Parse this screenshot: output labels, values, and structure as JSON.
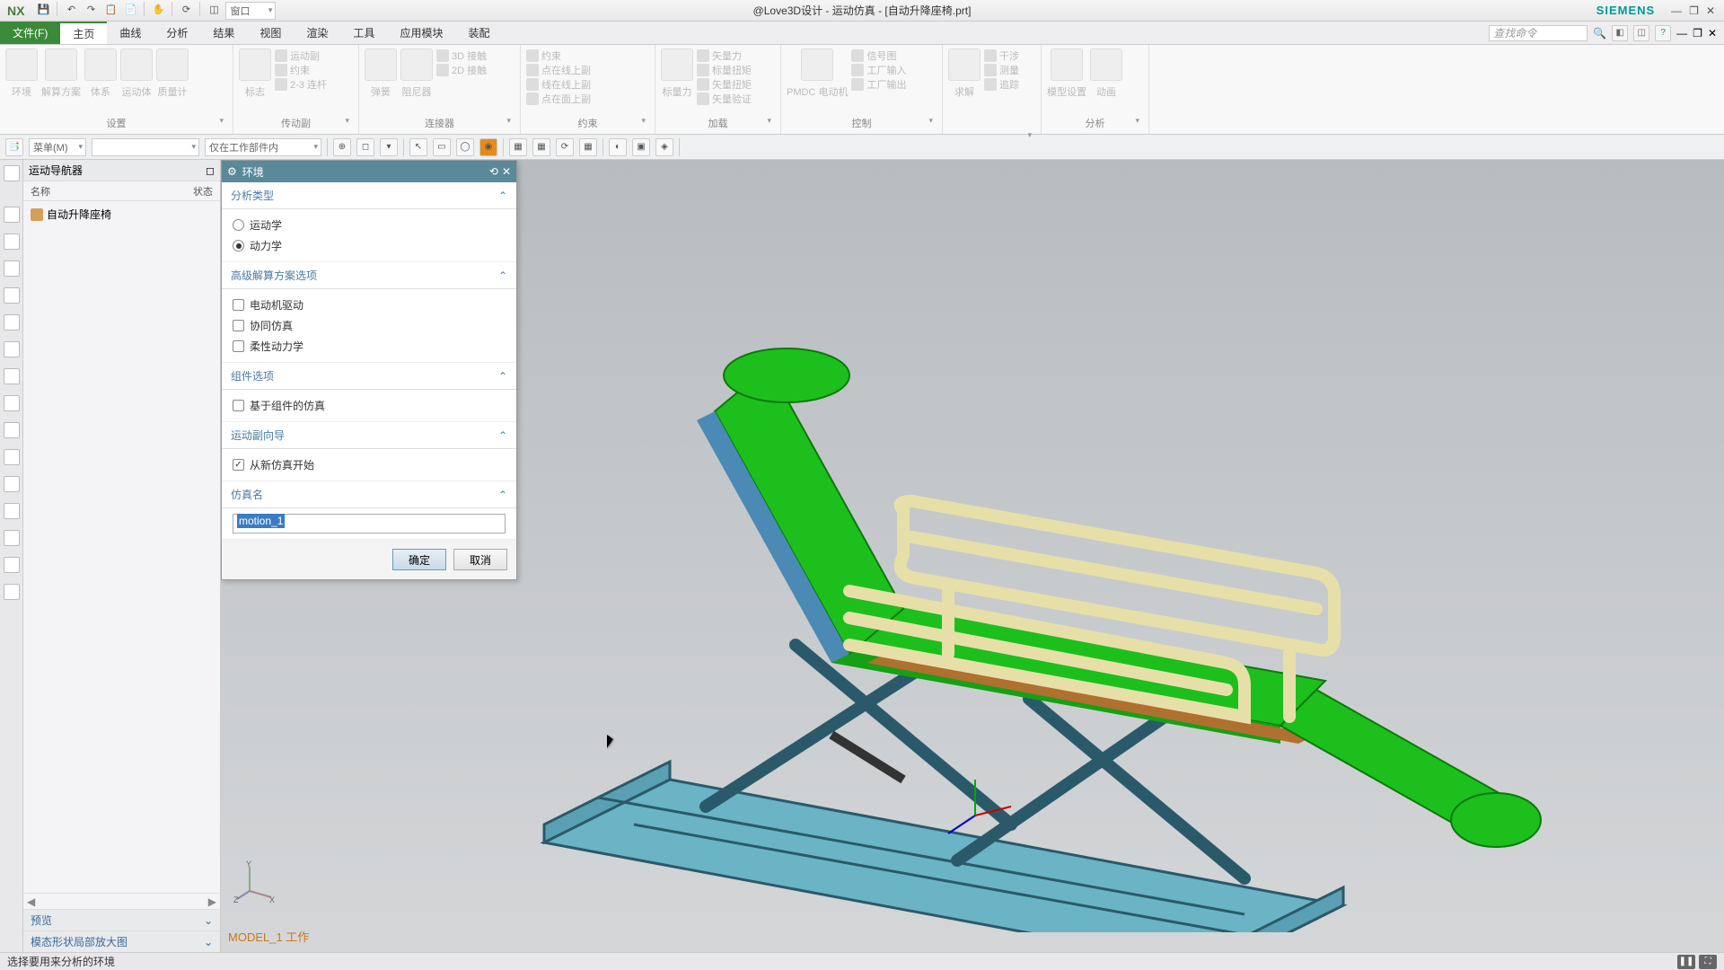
{
  "titlebar": {
    "logo": "NX",
    "window_dropdown": "窗口",
    "title": "@Love3D设计 - 运动仿真 - [自动升降座椅.prt]",
    "brand": "SIEMENS"
  },
  "menu": {
    "file": "文件(F)",
    "tabs": [
      "主页",
      "曲线",
      "分析",
      "结果",
      "视图",
      "渲染",
      "工具",
      "应用模块",
      "装配"
    ],
    "search_placeholder": "查找命令"
  },
  "ribbon": {
    "groups": [
      {
        "label": "设置",
        "items": [
          "环境",
          "解算方案",
          "体系",
          "运动体",
          "质量计"
        ]
      },
      {
        "label": "传动副",
        "items": [
          "标志",
          "运动副",
          "约束",
          "2-3 连杆"
        ]
      },
      {
        "label": "连接器",
        "items": [
          "弹簧",
          "阻尼器",
          "3D 接触",
          "2D 接触"
        ]
      },
      {
        "label": "约束",
        "items": [
          "约束",
          "点在线上副",
          "线在线上副",
          "点在面上副"
        ]
      },
      {
        "label": "加载",
        "items": [
          "标量力",
          "矢量力",
          "标量扭矩",
          "矢量扭矩",
          "矢量验证"
        ]
      },
      {
        "label": "控制",
        "items": [
          "PMDC 电动机",
          "信号图",
          "工厂输入",
          "工厂输出"
        ]
      },
      {
        "label": "",
        "items": [
          "求解",
          "干涉",
          "测量",
          "追踪"
        ]
      },
      {
        "label": "分析",
        "items": [
          "模型设置",
          "动画"
        ]
      }
    ]
  },
  "toolbar2": {
    "menu_btn": "菜单(M)",
    "combo1": "",
    "combo2": "仅在工作部件内"
  },
  "navigator": {
    "title": "运动导航器",
    "cols": {
      "name": "名称",
      "status": "状态"
    },
    "tree": {
      "root": "自动升降座椅"
    },
    "preview": "预览",
    "mode": "模态形状局部放大图"
  },
  "dialog": {
    "title": "环境",
    "sections": {
      "analysis_type": "分析类型",
      "advanced": "高级解算方案选项",
      "component": "组件选项",
      "motion_wiz": "运动副向导",
      "sim_name": "仿真名"
    },
    "radios": {
      "kinematics": "运动学",
      "dynamics": "动力学"
    },
    "checks": {
      "motor": "电动机驱动",
      "cosim": "协同仿真",
      "flex": "柔性动力学",
      "comp": "基于组件的仿真",
      "fromnew": "从新仿真开始"
    },
    "sim_name_value": "motion_1",
    "buttons": {
      "ok": "确定",
      "cancel": "取消"
    }
  },
  "viewport": {
    "model_label": "MODEL_1 工作"
  },
  "statusbar": {
    "text": "选择要用来分析的环境"
  }
}
